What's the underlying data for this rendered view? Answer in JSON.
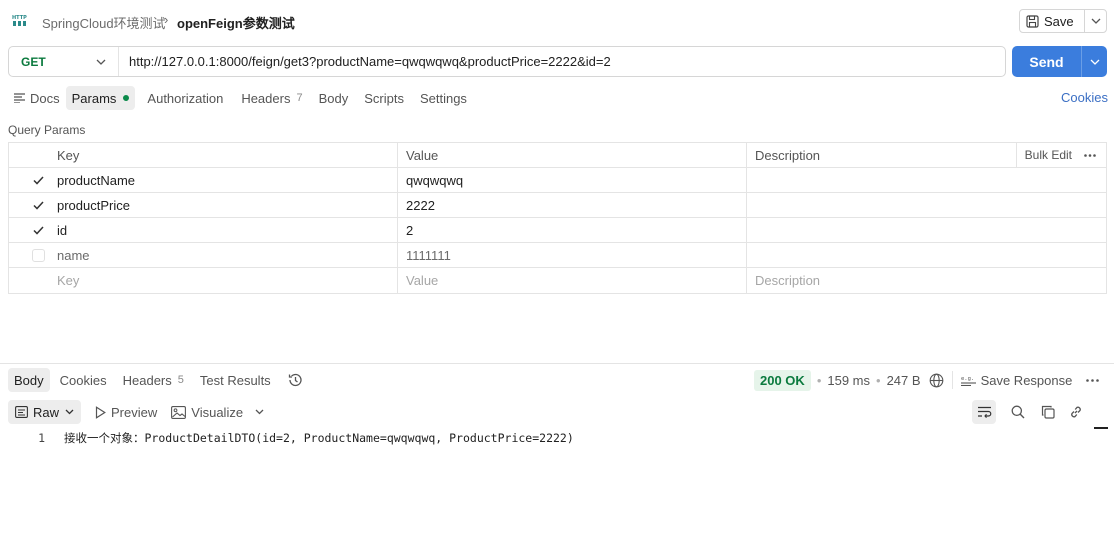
{
  "header": {
    "breadcrumb_parent": "SpringCloud环境测试",
    "breadcrumb_sep": "›",
    "breadcrumb_current": "openFeign参数测试",
    "save_label": "Save"
  },
  "request": {
    "method": "GET",
    "url": "http://127.0.0.1:8000/feign/get3?productName=qwqwqwq&productPrice=2222&id=2",
    "send_label": "Send"
  },
  "req_tabs": {
    "docs": "Docs",
    "params": "Params",
    "authorization": "Authorization",
    "headers": "Headers",
    "headers_count": "7",
    "body": "Body",
    "scripts": "Scripts",
    "settings": "Settings",
    "cookies": "Cookies"
  },
  "params": {
    "section_label": "Query Params",
    "col_key": "Key",
    "col_value": "Value",
    "col_description": "Description",
    "bulk_edit": "Bulk Edit",
    "rows": [
      {
        "key": "productName",
        "value": "qwqwqwq",
        "checked": true
      },
      {
        "key": "productPrice",
        "value": "2222",
        "checked": true
      },
      {
        "key": "id",
        "value": "2",
        "checked": true
      },
      {
        "key": "name",
        "value": "1111111",
        "checked": false
      }
    ],
    "placeholder_key": "Key",
    "placeholder_value": "Value",
    "placeholder_description": "Description"
  },
  "response": {
    "tabs": {
      "body": "Body",
      "cookies": "Cookies",
      "headers": "Headers",
      "headers_count": "5",
      "test_results": "Test Results"
    },
    "status": "200 OK",
    "time": "159 ms",
    "size": "247 B",
    "save_response": "Save Response",
    "format_raw": "Raw",
    "preview": "Preview",
    "visualize": "Visualize",
    "line_number": "1",
    "body_text": "接收一个对象：ProductDetailDTO(id=2, ProductName=qwqwqwq, ProductPrice=2222)"
  },
  "colors": {
    "send_bg": "#3b7ddd",
    "method_get": "#0b7a3e",
    "status_ok": "#0b7a3e",
    "link": "#3b6fc4"
  }
}
